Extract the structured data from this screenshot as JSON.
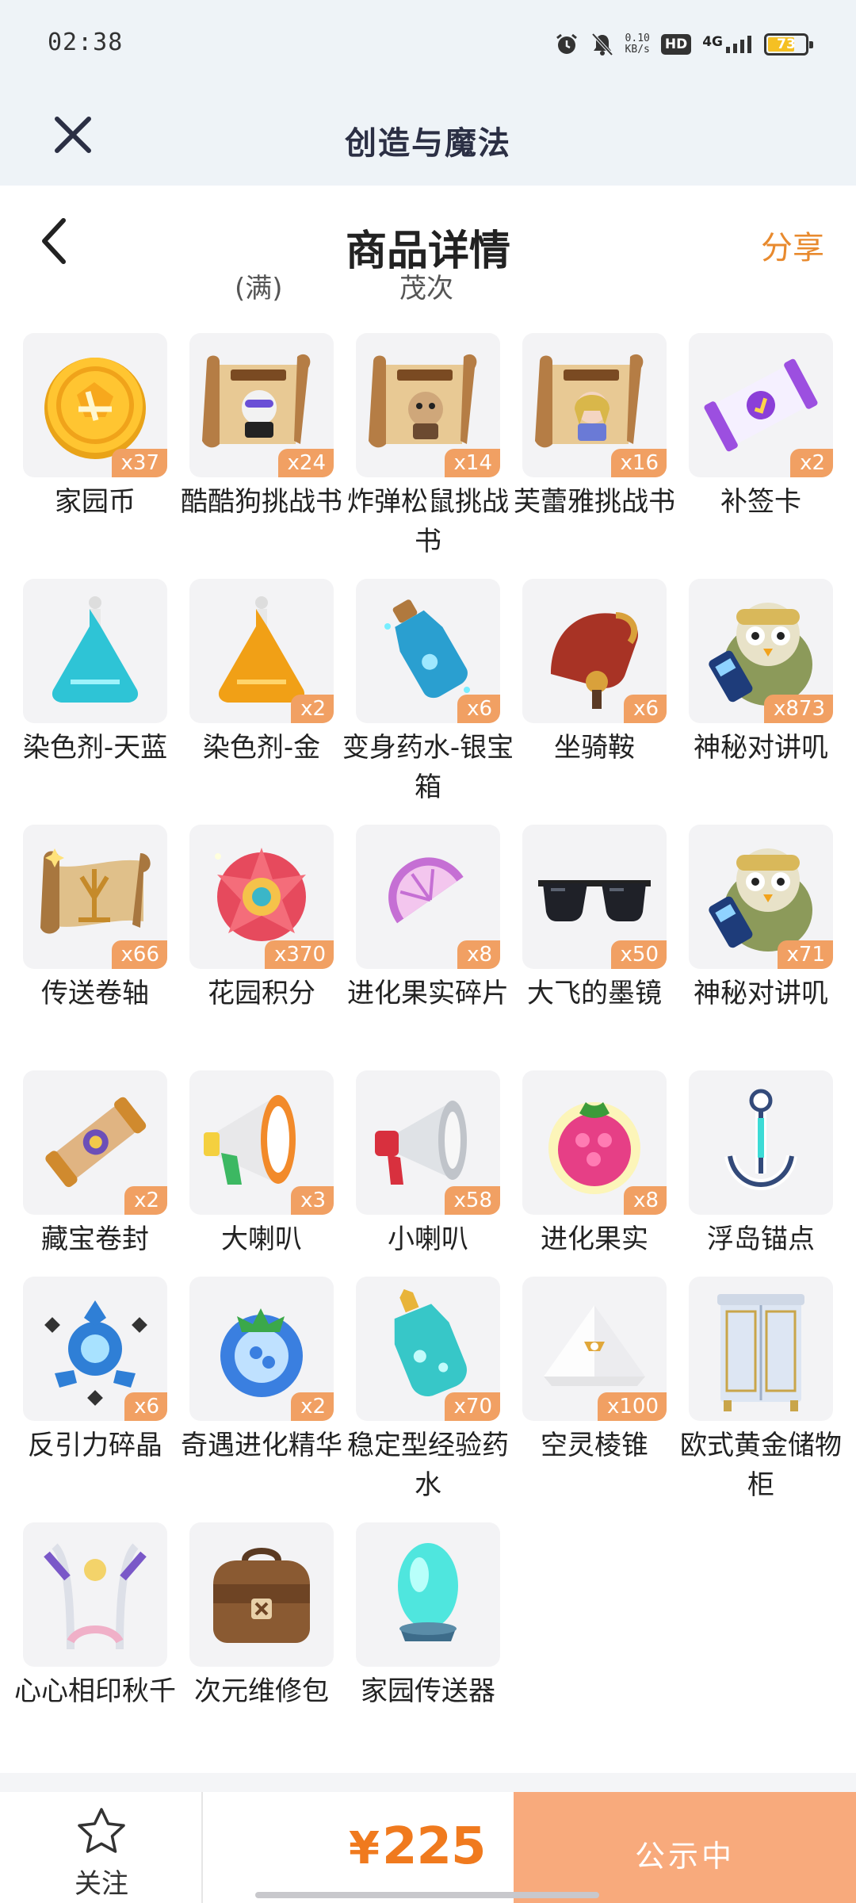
{
  "status_bar": {
    "time": "02:38",
    "net_speed_value": "0.10",
    "net_speed_unit": "KB/s",
    "hd": "HD",
    "network": "4G",
    "battery": "73"
  },
  "app_bar": {
    "title": "创造与魔法"
  },
  "nav": {
    "title": "商品详情",
    "share": "分享"
  },
  "cut_labels": [
    "(满)",
    "茂次"
  ],
  "items": [
    {
      "name": "家园币",
      "qty": "x37",
      "icon": "coin-icon"
    },
    {
      "name": "酷酷狗挑战书",
      "qty": "x24",
      "icon": "wanted-scroll-dog-icon"
    },
    {
      "name": "炸弹松鼠挑战书",
      "qty": "x14",
      "icon": "wanted-scroll-squirrel-icon"
    },
    {
      "name": "芙蕾雅挑战书",
      "qty": "x16",
      "icon": "wanted-scroll-freya-icon"
    },
    {
      "name": "补签卡",
      "qty": "x2",
      "icon": "makeup-card-icon"
    },
    {
      "name": "染色剂-天蓝",
      "qty": "",
      "icon": "sky-blue-dye-icon"
    },
    {
      "name": "染色剂-金",
      "qty": "x2",
      "icon": "gold-dye-icon"
    },
    {
      "name": "变身药水-银宝箱",
      "qty": "x6",
      "icon": "transform-potion-icon"
    },
    {
      "name": "坐骑鞍",
      "qty": "x6",
      "icon": "saddle-icon"
    },
    {
      "name": "神秘对讲叽",
      "qty": "x873",
      "icon": "walkie-talkie-bird-icon"
    },
    {
      "name": "传送卷轴",
      "qty": "x66",
      "icon": "teleport-scroll-icon"
    },
    {
      "name": "花园积分",
      "qty": "x370",
      "icon": "garden-points-flower-icon"
    },
    {
      "name": "进化果实碎片",
      "qty": "x8",
      "icon": "fruit-fragment-icon"
    },
    {
      "name": "大飞的墨镜",
      "qty": "x50",
      "icon": "sunglasses-icon"
    },
    {
      "name": "神秘对讲叽",
      "qty": "x71",
      "icon": "walkie-talkie-bird-icon"
    },
    {
      "name": "藏宝卷封",
      "qty": "x2",
      "icon": "treasure-scroll-icon"
    },
    {
      "name": "大喇叭",
      "qty": "x3",
      "icon": "big-megaphone-icon"
    },
    {
      "name": "小喇叭",
      "qty": "x58",
      "icon": "small-megaphone-icon"
    },
    {
      "name": "进化果实",
      "qty": "x8",
      "icon": "evolution-fruit-icon"
    },
    {
      "name": "浮岛锚点",
      "qty": "",
      "icon": "island-anchor-icon"
    },
    {
      "name": "反引力碎晶",
      "qty": "x6",
      "icon": "antigravity-crystal-icon"
    },
    {
      "name": "奇遇进化精华",
      "qty": "x2",
      "icon": "evolution-essence-icon"
    },
    {
      "name": "稳定型经验药水",
      "qty": "x70",
      "icon": "exp-potion-icon"
    },
    {
      "name": "空灵棱锥",
      "qty": "x100",
      "icon": "ethereal-pyramid-icon"
    },
    {
      "name": "欧式黄金储物柜",
      "qty": "",
      "icon": "wardrobe-icon"
    },
    {
      "name": "心心相印秋千",
      "qty": "",
      "icon": "swing-icon"
    },
    {
      "name": "次元维修包",
      "qty": "",
      "icon": "repair-bag-icon"
    },
    {
      "name": "家园传送器",
      "qty": "",
      "icon": "home-teleporter-icon"
    }
  ],
  "bottom_bar": {
    "follow_label": "关注",
    "price_symbol": "¥",
    "price": "225",
    "status_label": "公示中"
  },
  "colors": {
    "accent": "#f07a1e",
    "share": "#e88a2e",
    "qty_badge": "#f1a063",
    "status_button": "#f8aa7c",
    "header_bg": "#eef3f7"
  }
}
